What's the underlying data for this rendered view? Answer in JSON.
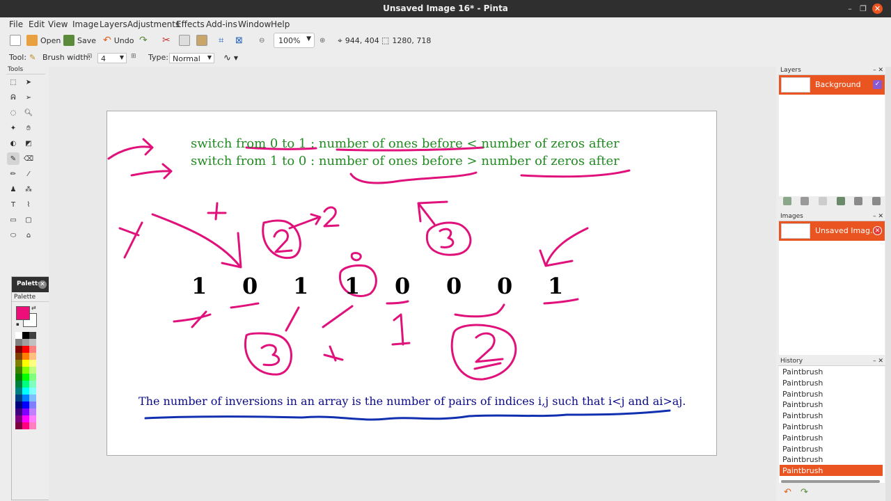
{
  "window": {
    "title": "Unsaved Image 16* - Pinta"
  },
  "menu": [
    "File",
    "Edit",
    "View",
    "Image",
    "Layers",
    "Adjustments",
    "Effects",
    "Add-ins",
    "Window",
    "Help"
  ],
  "toolbar": {
    "new_label": "",
    "open_label": "Open",
    "save_label": "Save",
    "undo_label": "Undo",
    "zoom": "100%",
    "cursor_pos": "944, 404",
    "image_size": "1280, 718"
  },
  "toolbar2": {
    "tool_label": "Tool:",
    "brush_width_label": "Brush width:",
    "brush_width": "4",
    "type_label": "Type:",
    "type_value": "Normal"
  },
  "tools": {
    "header": "Tools"
  },
  "palette": {
    "title": "Palette",
    "sub": "Palette",
    "primary": "#ec0f7a",
    "secondary": "#ffffff",
    "swatches": [
      "#ffffff",
      "#000000",
      "#404040",
      "#808080",
      "#a0a0a0",
      "#c0c0c0",
      "#7f0000",
      "#ff0000",
      "#ff7f7f",
      "#7f3f00",
      "#ff7f00",
      "#ffbf7f",
      "#7f7f00",
      "#ffff00",
      "#ffff7f",
      "#3f7f00",
      "#7fff00",
      "#bfff7f",
      "#007f00",
      "#00ff00",
      "#7fff7f",
      "#007f3f",
      "#00ff7f",
      "#7fffbf",
      "#007f7f",
      "#00ffff",
      "#7fffff",
      "#003f7f",
      "#007fff",
      "#7fbfff",
      "#00007f",
      "#0000ff",
      "#7f7fff",
      "#3f007f",
      "#7f00ff",
      "#bf7fff",
      "#7f007f",
      "#ff00ff",
      "#ff7fff",
      "#7f003f",
      "#ff007f",
      "#ff7fbf"
    ]
  },
  "canvas": {
    "line1": "switch  from  0  to  1  :  number  of  ones  before  <  number  of  zeros  after",
    "line2": "switch  from  1  to  0  :  number  of  ones  before  >  number  of  zeros  after",
    "digits": [
      "1",
      "0",
      "1",
      "1",
      "0",
      "0",
      "0",
      "1"
    ],
    "bottom_text": "The  number  of  inversions  in  an  array  is  the  number  of  pairs  of  indices  i,j  such  that  i<j  and  ai>aj.",
    "ink_color": "#e0117a",
    "underline_color": "#1030b0"
  },
  "layers": {
    "header": "Layers",
    "items": [
      {
        "name": "Background"
      }
    ]
  },
  "images": {
    "header": "Images",
    "items": [
      {
        "name": "Unsaved Imag..."
      }
    ]
  },
  "history": {
    "header": "History",
    "items": [
      "Paintbrush",
      "Paintbrush",
      "Paintbrush",
      "Paintbrush",
      "Paintbrush",
      "Paintbrush",
      "Paintbrush",
      "Paintbrush",
      "Paintbrush",
      "Paintbrush"
    ]
  }
}
